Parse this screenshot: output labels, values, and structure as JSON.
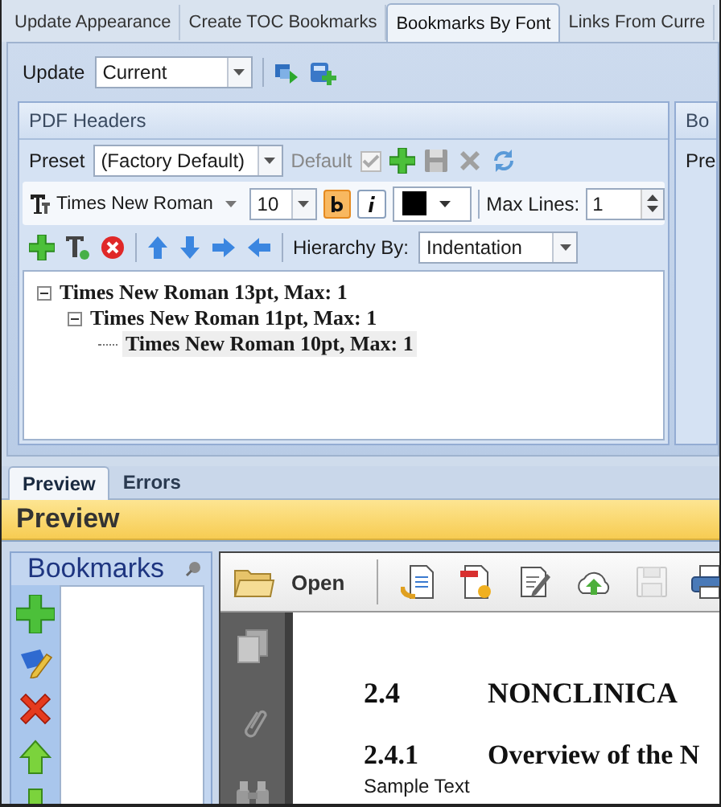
{
  "tabs": [
    {
      "label": "Update Appearance",
      "selected": false
    },
    {
      "label": "Create TOC Bookmarks",
      "selected": false
    },
    {
      "label": "Bookmarks By Font",
      "selected": true
    },
    {
      "label": "Links From Curre",
      "selected": false
    }
  ],
  "update": {
    "label": "Update",
    "value": "Current"
  },
  "pdf_headers": {
    "title": "PDF Headers",
    "preset": {
      "label": "Preset",
      "value": "(Factory Default)"
    },
    "default": {
      "label": "Default",
      "checked": true,
      "disabled": true
    },
    "font": {
      "name": "Times New Roman",
      "size": "10",
      "bold": true,
      "italic": false,
      "color": "#000000"
    },
    "max_lines": {
      "label": "Max Lines:",
      "value": "1"
    },
    "hierarchy": {
      "label": "Hierarchy By:",
      "value": "Indentation"
    },
    "tree": [
      {
        "label": "Times New Roman 13pt, Max: 1",
        "expanded": true,
        "selected": false,
        "children": [
          {
            "label": "Times New Roman 11pt, Max: 1",
            "expanded": true,
            "selected": false,
            "children": [
              {
                "label": "Times New Roman 10pt, Max: 1",
                "selected": true
              }
            ]
          }
        ]
      }
    ]
  },
  "side_panel": {
    "title": "Bo",
    "label": "Pre"
  },
  "bottom_tabs": [
    {
      "label": "Preview",
      "selected": true
    },
    {
      "label": "Errors",
      "selected": false
    }
  ],
  "preview_title": "Preview",
  "bookmarks": {
    "title": "Bookmarks"
  },
  "viewer": {
    "open_label": "Open",
    "save_disabled": true,
    "page": [
      {
        "kind": "heading",
        "number": "2.4",
        "text": "NONCLINICA"
      },
      {
        "kind": "subheading",
        "number": "2.4.1",
        "text": "Overview of the N"
      },
      {
        "kind": "body",
        "text": "Sample Text"
      }
    ]
  }
}
